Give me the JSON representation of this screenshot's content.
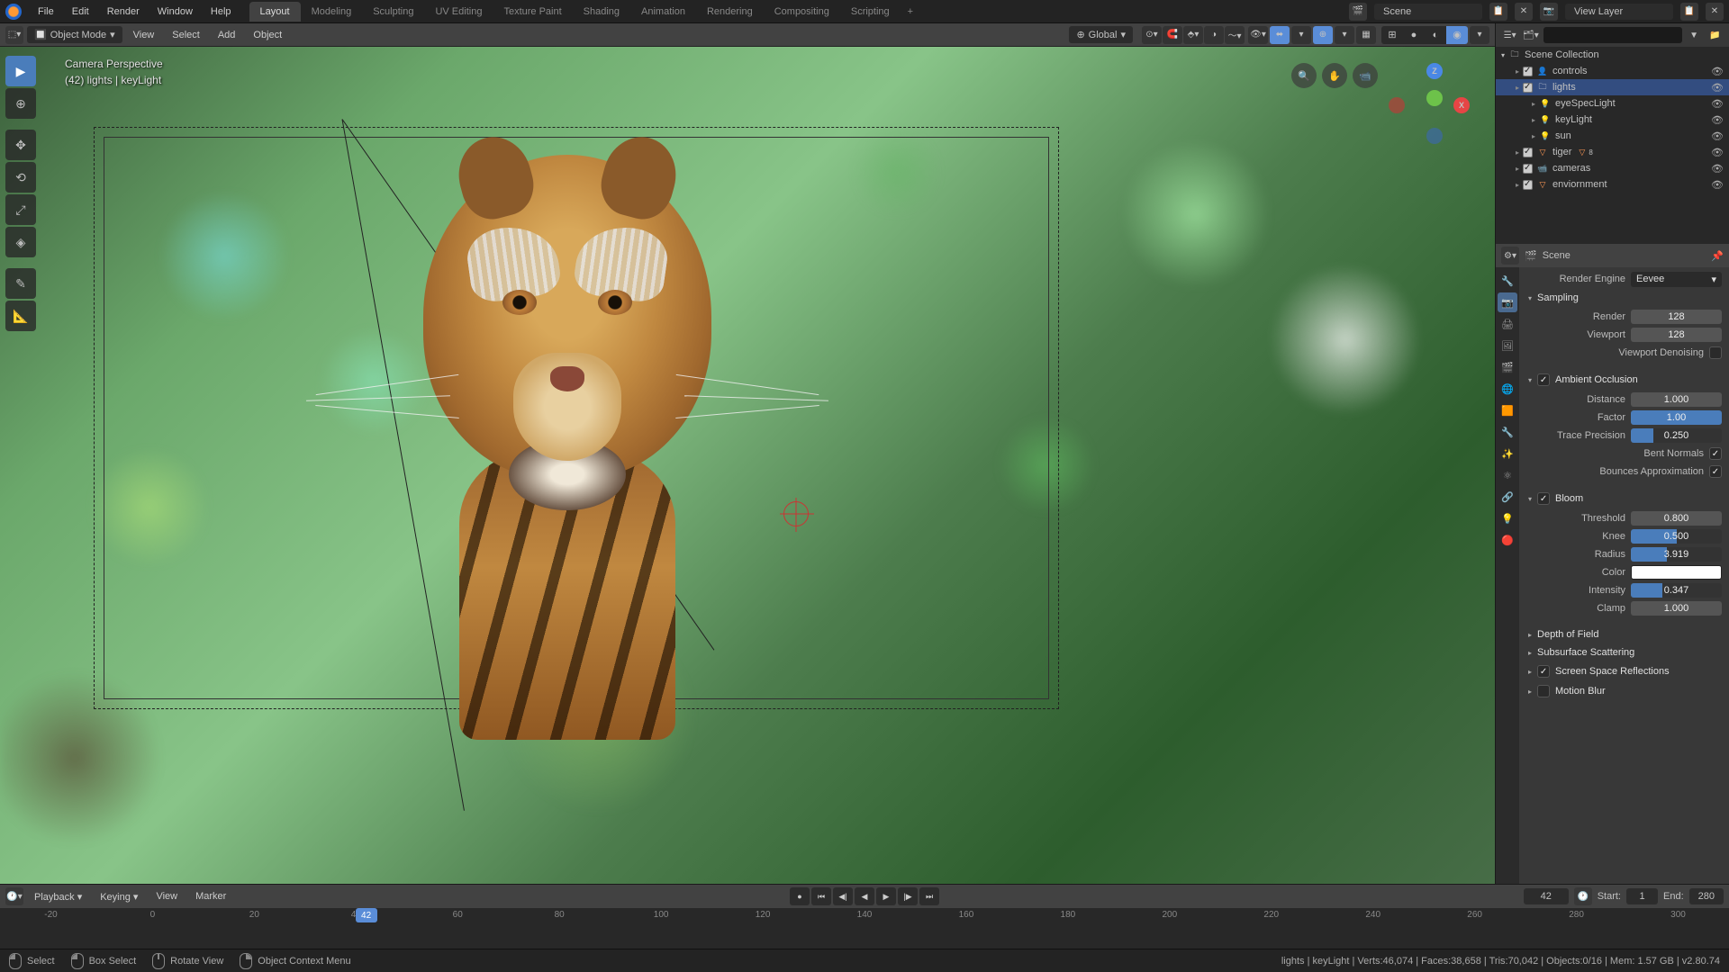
{
  "topmenu": {
    "file": "File",
    "edit": "Edit",
    "render": "Render",
    "window": "Window",
    "help": "Help"
  },
  "workspaces": [
    "Layout",
    "Modeling",
    "Sculpting",
    "UV Editing",
    "Texture Paint",
    "Shading",
    "Animation",
    "Rendering",
    "Compositing",
    "Scripting"
  ],
  "active_workspace": 0,
  "top_right": {
    "scene": "Scene",
    "viewlayer": "View Layer"
  },
  "vp_header": {
    "mode": "Object Mode",
    "view": "View",
    "select": "Select",
    "add": "Add",
    "object": "Object",
    "orientation": "Global"
  },
  "vp_overlay": {
    "line1": "Camera Perspective",
    "line2": "(42) lights | keyLight"
  },
  "gizmo": {
    "x": "X",
    "y": "",
    "z": "Z"
  },
  "tools": [
    "select",
    "cursor",
    "move",
    "rotate",
    "scale",
    "transform",
    "annotate",
    "measure"
  ],
  "outliner": {
    "root": "Scene Collection",
    "items": [
      {
        "name": "controls",
        "icon": "armature",
        "lvl": 1,
        "check": true
      },
      {
        "name": "lights",
        "icon": "coll",
        "lvl": 1,
        "check": true,
        "sel": true
      },
      {
        "name": "eyeSpecLight",
        "icon": "light",
        "lvl": 2
      },
      {
        "name": "keyLight",
        "icon": "light",
        "lvl": 2
      },
      {
        "name": "sun",
        "icon": "light",
        "lvl": 2
      },
      {
        "name": "tiger",
        "icon": "mesh",
        "lvl": 1,
        "check": true,
        "count": "8"
      },
      {
        "name": "cameras",
        "icon": "cam",
        "lvl": 1,
        "check": true
      },
      {
        "name": "enviornment",
        "icon": "mesh",
        "lvl": 1,
        "check": true
      }
    ]
  },
  "props": {
    "breadcrumb": "Scene",
    "engine_label": "Render Engine",
    "engine": "Eevee",
    "sampling": {
      "title": "Sampling",
      "render_label": "Render",
      "render": "128",
      "viewport_label": "Viewport",
      "viewport": "128",
      "denoise_label": "Viewport Denoising",
      "denoise": false
    },
    "ao": {
      "title": "Ambient Occlusion",
      "enabled": true,
      "distance_label": "Distance",
      "distance": "1.000",
      "factor_label": "Factor",
      "factor": "1.00",
      "factor_pct": 100,
      "trace_label": "Trace Precision",
      "trace": "0.250",
      "trace_pct": 25,
      "bent_label": "Bent Normals",
      "bent": true,
      "bounce_label": "Bounces Approximation",
      "bounce": true
    },
    "bloom": {
      "title": "Bloom",
      "enabled": true,
      "threshold_label": "Threshold",
      "threshold": "0.800",
      "knee_label": "Knee",
      "knee": "0.500",
      "knee_pct": 50,
      "radius_label": "Radius",
      "radius": "3.919",
      "radius_pct": 40,
      "color_label": "Color",
      "intensity_label": "Intensity",
      "intensity": "0.347",
      "intensity_pct": 35,
      "clamp_label": "Clamp",
      "clamp": "1.000"
    },
    "dof": "Depth of Field",
    "sss": "Subsurface Scattering",
    "ssr": "Screen Space Reflections",
    "ssr_on": true,
    "mblur": "Motion Blur",
    "mblur_on": false
  },
  "timeline": {
    "menus": {
      "playback": "Playback",
      "keying": "Keying",
      "view": "View",
      "marker": "Marker"
    },
    "current": 42,
    "start_label": "Start:",
    "start": 1,
    "end_label": "End:",
    "end": 280,
    "ticks": [
      -20,
      0,
      20,
      40,
      60,
      80,
      100,
      120,
      140,
      160,
      180,
      200,
      220,
      240,
      260,
      280,
      300
    ]
  },
  "status": {
    "left": [
      {
        "ic": "l",
        "label": "Select"
      },
      {
        "ic": "l",
        "label": "Box Select"
      },
      {
        "ic": "m",
        "label": "Rotate View"
      },
      {
        "ic": "r",
        "label": "Object Context Menu"
      }
    ],
    "right": "lights | keyLight | Verts:46,074 | Faces:38,658 | Tris:70,042 | Objects:0/16 | Mem: 1.57 GB | v2.80.74"
  }
}
